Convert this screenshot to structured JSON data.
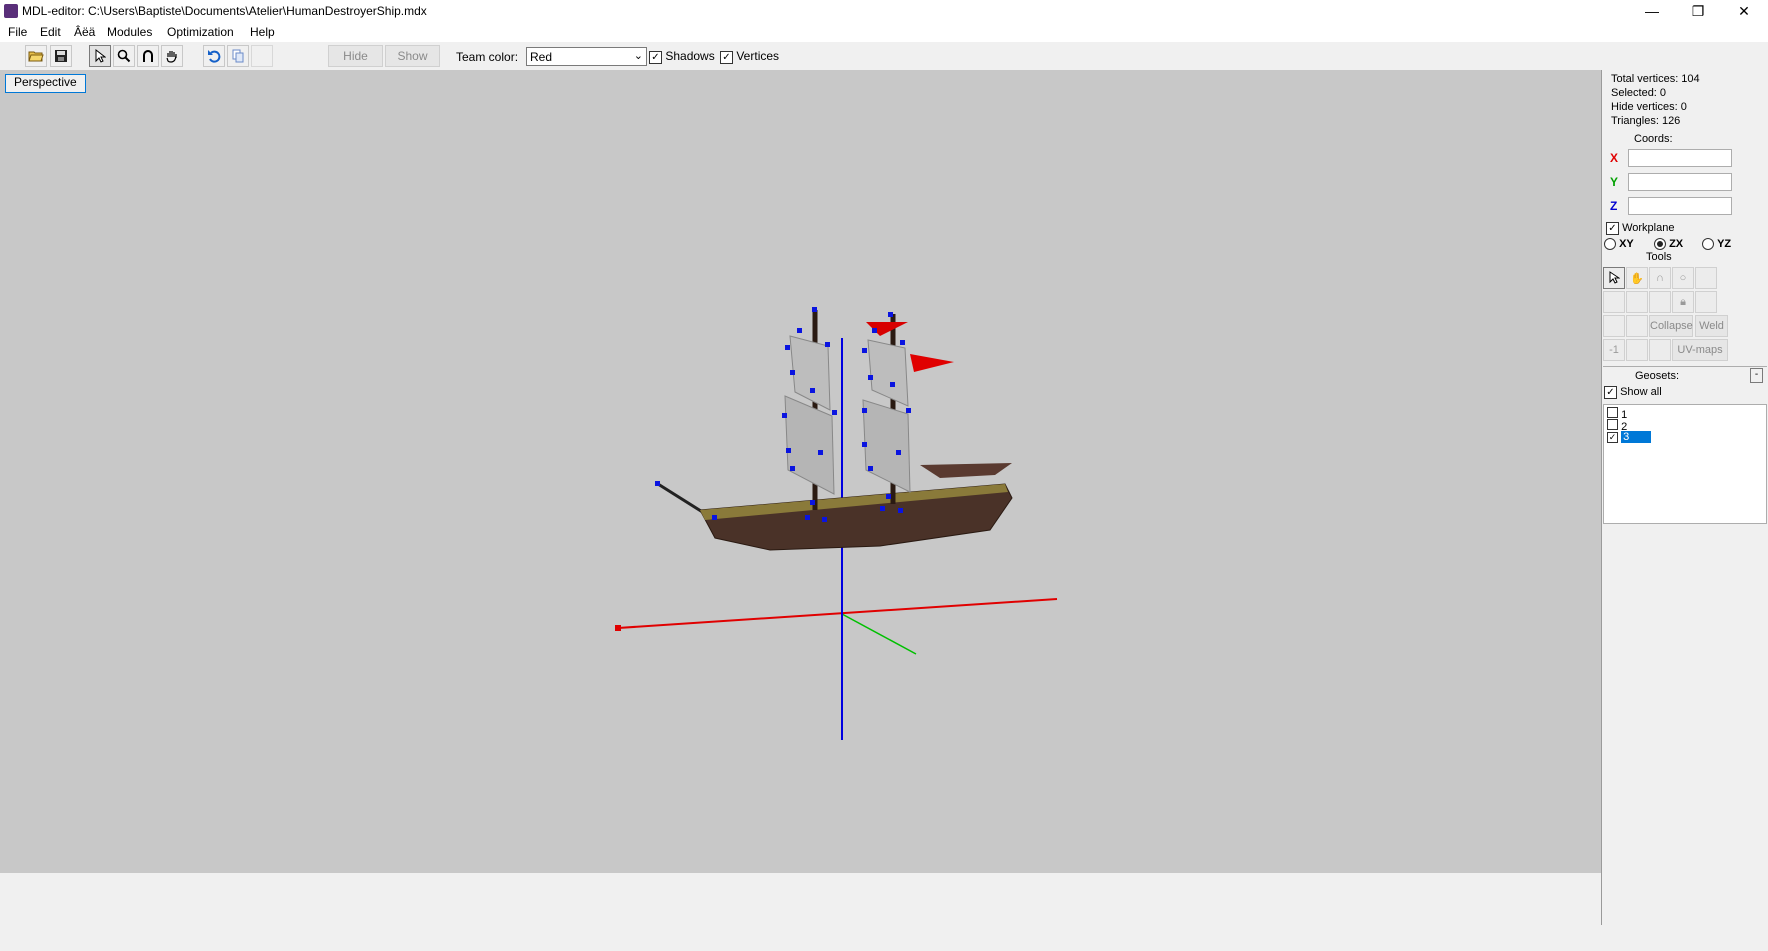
{
  "window": {
    "title": "MDL-editor: C:\\Users\\Baptiste\\Documents\\Atelier\\HumanDestroyerShip.mdx",
    "minimize": "—",
    "restore": "❐",
    "close": "✕"
  },
  "menu": [
    "File",
    "Edit",
    "Âëä",
    "Modules",
    "Optimization",
    "Help"
  ],
  "toolbar": {
    "hide_label": "Hide",
    "show_label": "Show",
    "team_color_label": "Team color:",
    "team_color_value": "Red",
    "shadows_label": "Shadows",
    "shadows_checked": true,
    "vertices_label": "Vertices",
    "vertices_checked": true
  },
  "viewport": {
    "view_tab": "Perspective",
    "background": "#c8c8c8"
  },
  "panel": {
    "total_vertices": "Total vertices: 104",
    "selected": "Selected: 0",
    "hide_vertices": "Hide vertices: 0",
    "triangles": "Triangles: 126",
    "coords_label": "Coords:",
    "x_label": "X",
    "y_label": "Y",
    "z_label": "Z",
    "workplane_label": "Workplane",
    "plane_xy": "XY",
    "plane_zx": "ZX",
    "plane_yz": "YZ",
    "selected_plane": "ZX",
    "tools_label": "Tools",
    "collapse_label": "Collapse",
    "weld_label": "Weld",
    "minus_one_label": "-1",
    "uvmaps_label": "UV-maps",
    "geosets_label": "Geosets:",
    "geosets_collapse": "-",
    "show_all_label": "Show all",
    "geosets": [
      {
        "label": "1",
        "checked": false,
        "selected": false
      },
      {
        "label": "2",
        "checked": false,
        "selected": false
      },
      {
        "label": "3",
        "checked": true,
        "selected": true
      }
    ]
  },
  "colors": {
    "x_axis": "#e00000",
    "y_axis": "#00b000",
    "z_axis": "#0000e0",
    "vertex": "#0a14e0",
    "selection": "#0078d7"
  }
}
